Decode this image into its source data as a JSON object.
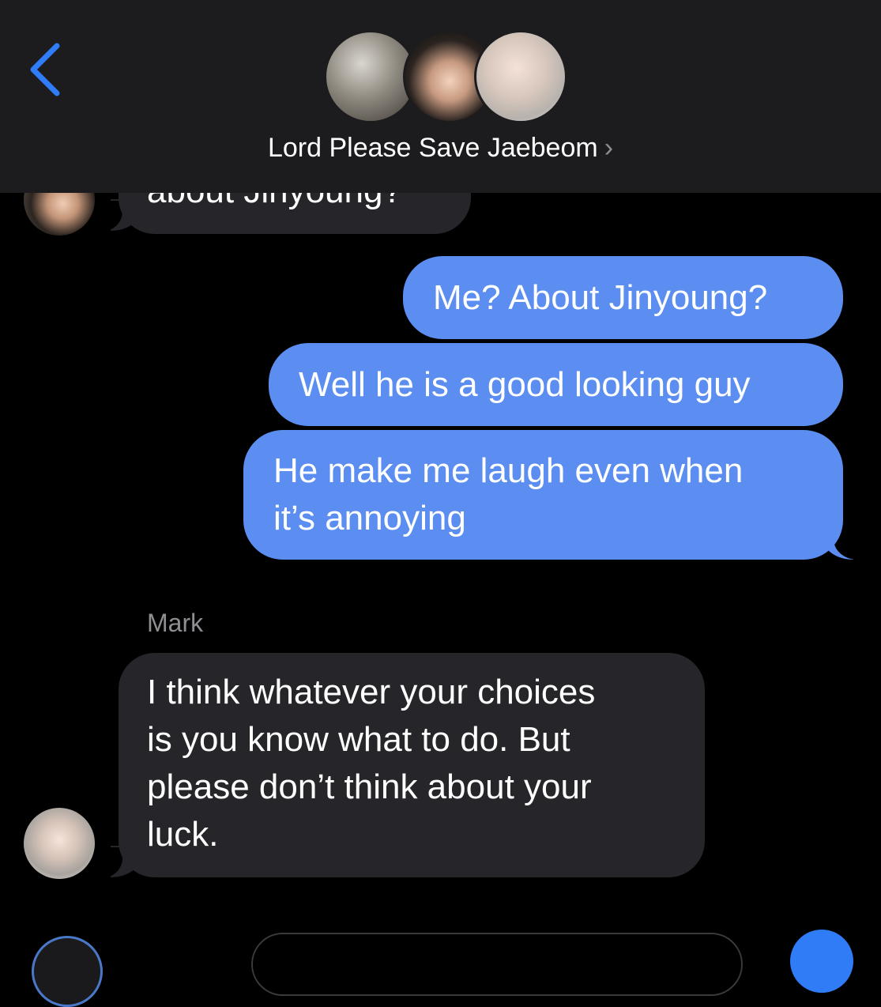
{
  "header": {
    "group_name": "Lord Please Save Jaebeom",
    "chevron": "›",
    "back_icon": "chevron-left-icon",
    "accent_color": "#2f7cf6"
  },
  "messages": [
    {
      "direction": "in",
      "sender": "",
      "text": "about Jinyoung?"
    },
    {
      "direction": "out",
      "text": "Me? About Jinyoung?"
    },
    {
      "direction": "out",
      "text": "Well he is a good looking guy"
    },
    {
      "direction": "out",
      "line1": "He make me laugh even when",
      "line2": "it’s annoying"
    },
    {
      "direction": "in",
      "sender": "Mark",
      "line1": "I think whatever your choices",
      "line2": "is you know what to do. But",
      "line3": "please don’t think about your",
      "line4": "luck."
    }
  ],
  "colors": {
    "outgoing_bubble": "#5b8ef0",
    "incoming_bubble": "#26262a",
    "header_bg": "#1c1c1e",
    "sender_name": "#8e8e93"
  }
}
